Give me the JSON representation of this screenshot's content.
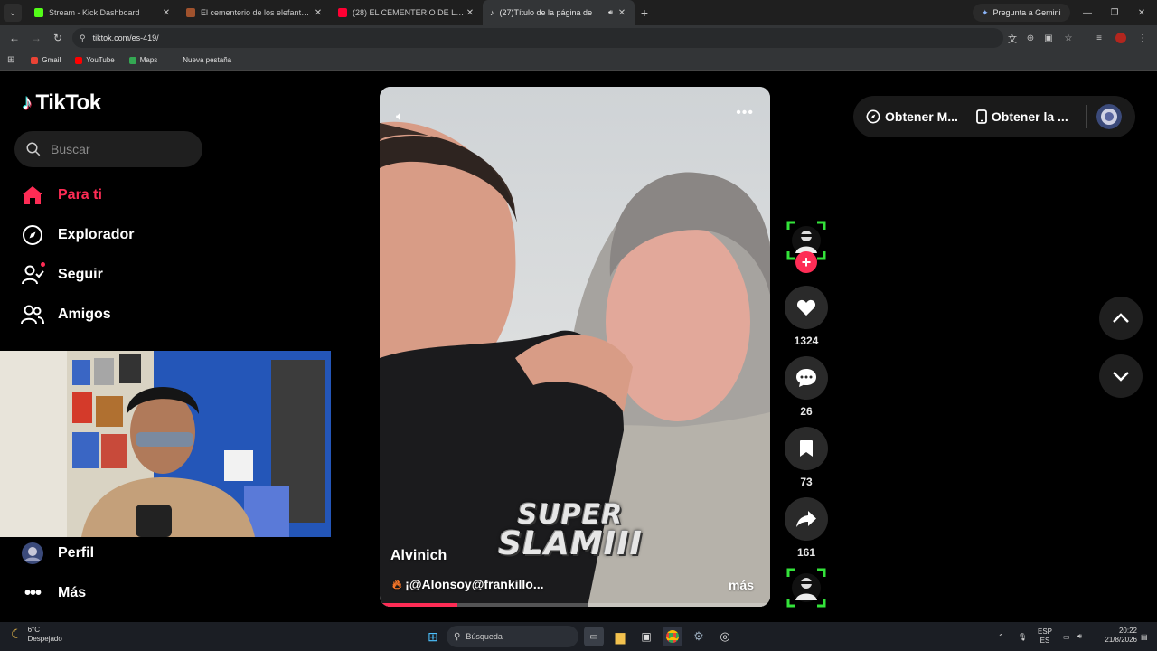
{
  "browser": {
    "tabs": [
      {
        "title": "Stream - Kick Dashboard",
        "color": "#53fc18"
      },
      {
        "title": "El cementerio de los elefantes /",
        "color": "#a0522d"
      },
      {
        "title": "(28) EL CEMENTERIO DE LOS EL",
        "color": "#ff0033"
      },
      {
        "title": "(27)Título de la página de",
        "color": "#ffffff"
      }
    ],
    "gemini_label": "Pregunta a Gemini",
    "url": "tiktok.com/es-419/",
    "bookmarks": [
      {
        "label": "Gmail",
        "color": "#ea4335"
      },
      {
        "label": "YouTube",
        "color": "#ff0000"
      },
      {
        "label": "Maps",
        "color": "#34a853"
      },
      {
        "label": "Nueva pestaña",
        "color": "#333537"
      }
    ]
  },
  "tiktok": {
    "logo": "TikTok",
    "search_placeholder": "Buscar",
    "nav": [
      {
        "label": "Para ti",
        "icon": "home-icon",
        "active": true
      },
      {
        "label": "Explorador",
        "icon": "compass-icon"
      },
      {
        "label": "Seguir",
        "icon": "follow-icon"
      },
      {
        "label": "Amigos",
        "icon": "friends-icon"
      },
      {
        "label": "Perfil",
        "icon": "profile-icon"
      },
      {
        "label": "Más",
        "icon": "more-icon"
      }
    ],
    "accent": "#fe2c55",
    "video": {
      "author": "Alvinich",
      "caption": "¡@Alonsoy@frankillo...",
      "more": "más",
      "overlay_line1": "SUPER",
      "overlay_line2": "SLAMIII",
      "progress": 0.2
    },
    "actions": {
      "likes": "1324",
      "comments": "26",
      "saves": "73",
      "shares": "161"
    },
    "header": {
      "get_app_1": "Obtener M...",
      "get_app_2": "Obtener la ..."
    }
  },
  "taskbar": {
    "temp": "6°C",
    "weather": "Despejado",
    "search": "Búsqueda",
    "lang1": "ESP",
    "lang2": "ES",
    "time": "20:22",
    "date": "21/8/2026"
  }
}
